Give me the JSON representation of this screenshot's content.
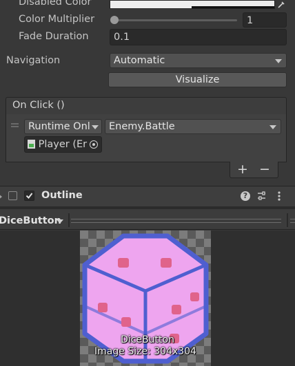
{
  "props": {
    "disabled_color_label": "Disabled Color",
    "color_multiplier_label": "Color Multiplier",
    "color_multiplier_value": "1",
    "color_multiplier_level": 0.0,
    "fade_duration_label": "Fade Duration",
    "fade_duration_value": "0.1",
    "navigation_label": "Navigation",
    "navigation_value": "Automatic",
    "visualize_label": "Visualize"
  },
  "onclick": {
    "header": "On Click ()",
    "runtime_value": "Runtime Onl",
    "function_value": "Enemy.Battle",
    "object_value": "Player (Er",
    "add_label": "+",
    "remove_label": "−"
  },
  "outline": {
    "title": "Outline",
    "enabled": true
  },
  "preview": {
    "dropdown_label": "DiceButton",
    "caption_name": "DiceButton",
    "caption_size": "Image Size: 304x304"
  },
  "icons": [
    "eyedropper-icon",
    "script-icon",
    "target-icon",
    "help-icon",
    "settings-icon",
    "more-icon",
    "checkbox-icon",
    "caret-icon"
  ],
  "colors": {
    "panel_bg": "#383838",
    "dice_fill": "#eea5ef",
    "dice_outline": "#4f5fd0",
    "dice_pip": "#e0638b"
  }
}
